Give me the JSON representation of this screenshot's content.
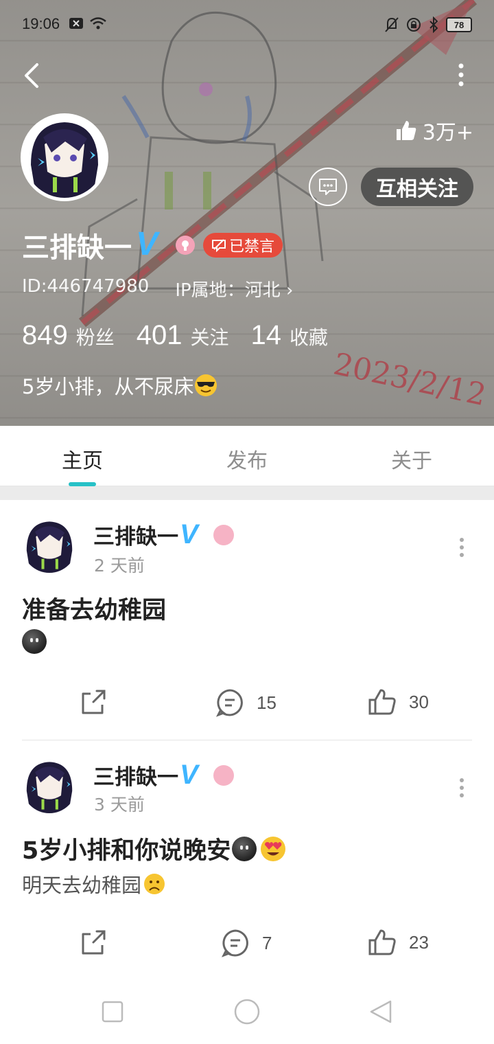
{
  "status_bar": {
    "time": "19:06",
    "battery": "78",
    "icons": [
      "close-box-icon",
      "wifi-icon",
      "bell-off-icon",
      "lock-rotate-icon",
      "bluetooth-icon",
      "battery-icon"
    ]
  },
  "profile": {
    "likes": "3万+",
    "follow_label": "互相关注",
    "name": "三排缺一",
    "vip_mark": "V",
    "banned_label": "已禁言",
    "id_text": "ID:446747980",
    "ip_text": "IP属地：河北",
    "stats": [
      {
        "value": "849",
        "label": "粉丝"
      },
      {
        "value": "401",
        "label": "关注"
      },
      {
        "value": "14",
        "label": "收藏"
      }
    ],
    "bio": "5岁小排，从不尿床",
    "cover_handwriting": "2023/2/12"
  },
  "tabs": [
    {
      "label": "主页",
      "active": true
    },
    {
      "label": "发布",
      "active": false
    },
    {
      "label": "关于",
      "active": false
    }
  ],
  "posts": [
    {
      "author": "三排缺一",
      "vip_mark": "V",
      "time": "2 天前",
      "title": "准备去幼稚园",
      "body": "",
      "comments": "15",
      "likes": "30"
    },
    {
      "author": "三排缺一",
      "vip_mark": "V",
      "time": "3 天前",
      "title": "5岁小排和你说晚安",
      "body": "明天去幼稚园",
      "comments": "7",
      "likes": "23"
    }
  ],
  "colors": {
    "accent": "#27c1c7",
    "vip_blue": "#3fb5ff",
    "banned_red": "#e64a3b",
    "badge_pink": "#f4a3b8"
  }
}
